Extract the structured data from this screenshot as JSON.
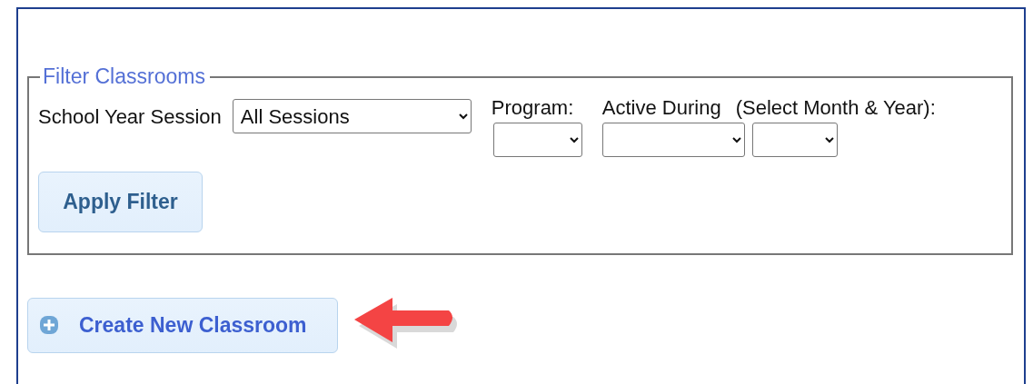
{
  "panel": {
    "legend": "Filter Classrooms"
  },
  "filters": {
    "session_label": "School Year Session",
    "session_value": "All Sessions",
    "program_label": "Program:",
    "active_label": "Active During",
    "month_year_label": "(Select Month & Year):"
  },
  "apply_button": "Apply Filter",
  "create_button": "Create New Classroom"
}
